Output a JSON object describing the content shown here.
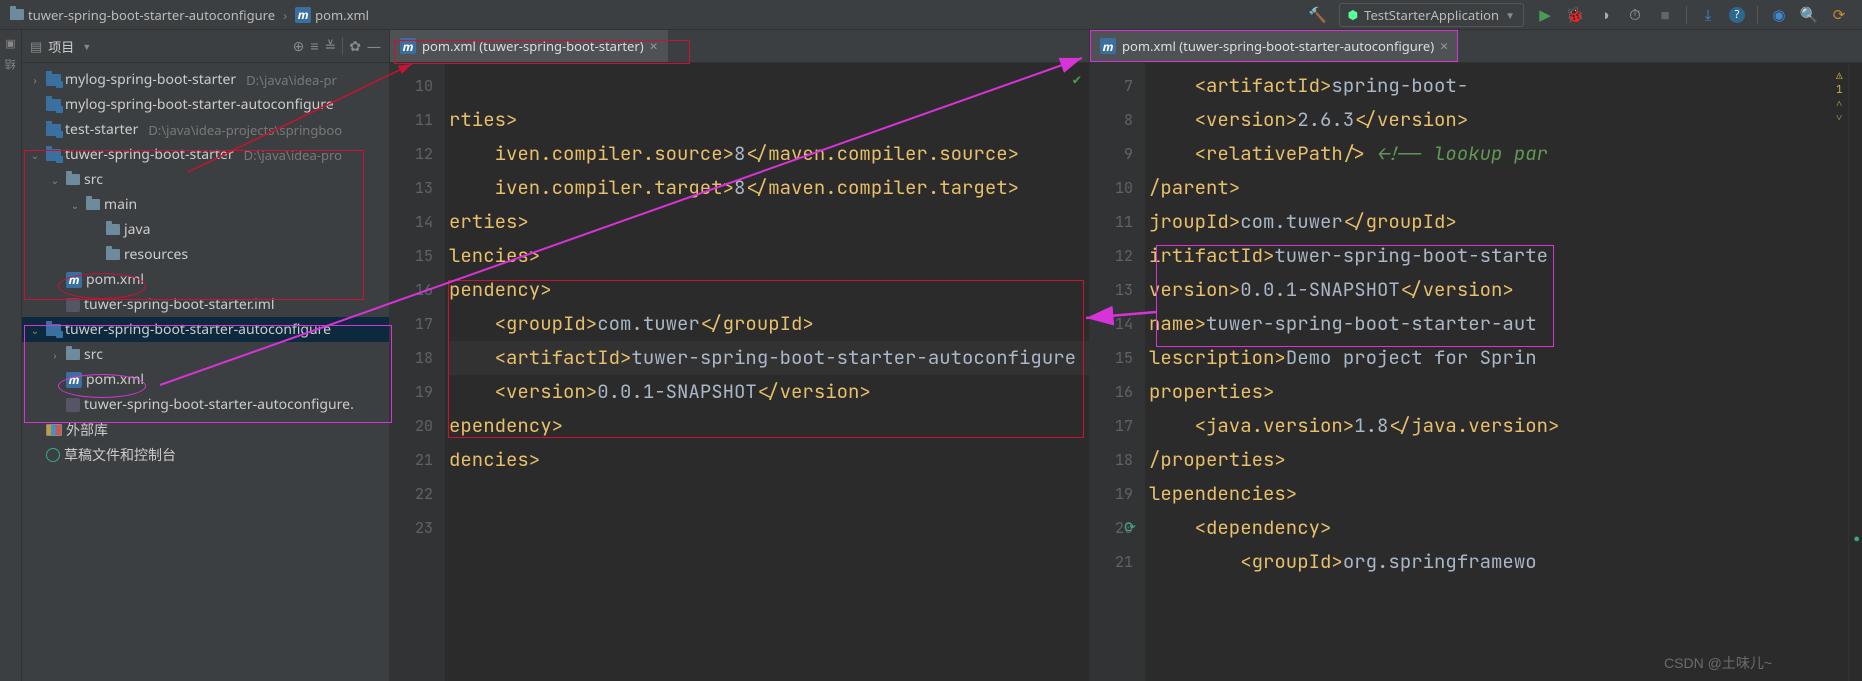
{
  "breadcrumb": {
    "module": "tuwer-spring-boot-starter-autoconfigure",
    "file": "pom.xml"
  },
  "toolbar": {
    "run_config": "TestStarterApplication"
  },
  "project": {
    "title": "项目",
    "items": [
      {
        "depth": 0,
        "chev": ">",
        "icon": "mod",
        "name": "mylog-spring-boot-starter",
        "path": "D:\\java\\idea-pr"
      },
      {
        "depth": 0,
        "chev": "",
        "icon": "mod",
        "name": "mylog-spring-boot-starter-autoconfigure",
        "path": ""
      },
      {
        "depth": 0,
        "chev": "",
        "icon": "mod",
        "name": "test-starter",
        "path": "D:\\java\\idea-projects\\springboo"
      },
      {
        "depth": 0,
        "chev": "v",
        "icon": "mod",
        "name": "tuwer-spring-boot-starter",
        "path": "D:\\java\\idea-pro"
      },
      {
        "depth": 1,
        "chev": "v",
        "icon": "dir",
        "name": "src",
        "path": ""
      },
      {
        "depth": 2,
        "chev": "v",
        "icon": "dir",
        "name": "main",
        "path": ""
      },
      {
        "depth": 3,
        "chev": "",
        "icon": "dir",
        "name": "java",
        "path": ""
      },
      {
        "depth": 3,
        "chev": "",
        "icon": "dir",
        "name": "resources",
        "path": ""
      },
      {
        "depth": 1,
        "chev": "",
        "icon": "m",
        "name": "pom.xml",
        "path": ""
      },
      {
        "depth": 1,
        "chev": "",
        "icon": "iml",
        "name": "tuwer-spring-boot-starter.iml",
        "path": ""
      },
      {
        "depth": 0,
        "chev": "v",
        "icon": "mod",
        "name": "tuwer-spring-boot-starter-autoconfigure",
        "path": "",
        "sel": true
      },
      {
        "depth": 1,
        "chev": ">",
        "icon": "dir",
        "name": "src",
        "path": ""
      },
      {
        "depth": 1,
        "chev": "",
        "icon": "m",
        "name": "pom.xml",
        "path": ""
      },
      {
        "depth": 1,
        "chev": "",
        "icon": "iml",
        "name": "tuwer-spring-boot-starter-autoconfigure.",
        "path": ""
      },
      {
        "depth": 0,
        "chev": "",
        "icon": "lib",
        "name": "外部库",
        "path": ""
      },
      {
        "depth": 0,
        "chev": "",
        "icon": "scratch",
        "name": "草稿文件和控制台",
        "path": ""
      }
    ]
  },
  "editorLeft": {
    "tab": "pom.xml (tuwer-spring-boot-starter)",
    "startLine": 10,
    "lines": [
      "",
      "rties>",
      "    iven.compiler.source>8</maven.compiler.source>",
      "    iven.compiler.target>8</maven.compiler.target>",
      "erties>",
      "lencies>",
      "pendency>",
      "    <groupId>com.tuwer</groupId>",
      "    <artifactId>tuwer-spring-boot-starter-autoconfigure",
      "    <version>0.0.1-SNAPSHOT</version>",
      "ependency>",
      "dencies>",
      "",
      ""
    ]
  },
  "editorRight": {
    "tab": "pom.xml (tuwer-spring-boot-starter-autoconfigure)",
    "startLine": 7,
    "lines": [
      "    <artifactId>spring-boot-",
      "    <version>2.6.3</version>",
      "    <relativePath/> <!-- lookup par",
      "/parent>",
      "jroupId>com.tuwer</groupId>",
      "irtifactId>tuwer-spring-boot-starte",
      "version>0.0.1-SNAPSHOT</version>",
      "name>tuwer-spring-boot-starter-aut",
      "lescription>Demo project for Sprin",
      "properties>",
      "    <java.version>1.8</java.version>",
      "/properties>",
      "lependencies>",
      "    <dependency>",
      "        <groupId>org.springframewo"
    ]
  },
  "watermark": "CSDN @土味儿~"
}
